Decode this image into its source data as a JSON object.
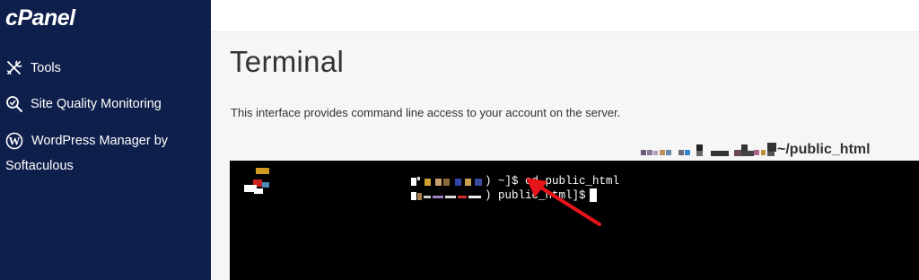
{
  "sidebar": {
    "logo": "cPanel",
    "items": [
      {
        "label": "Tools",
        "icon": "tools-icon"
      },
      {
        "label": "Site Quality Monitoring",
        "icon": "site-quality-icon"
      },
      {
        "label": "WordPress Manager by Softaculous",
        "icon": "wordpress-icon"
      }
    ],
    "background_color": "#0f1f4b"
  },
  "main": {
    "title": "Terminal",
    "description": "This interface provides command line access to your account on the server.",
    "current_path": "~/public_html"
  },
  "terminal": {
    "line1_suffix": ") ~]$ cd public_html",
    "line2_suffix": ") public_html]$"
  },
  "annotation": {
    "arrow_color": "#e8141b"
  }
}
